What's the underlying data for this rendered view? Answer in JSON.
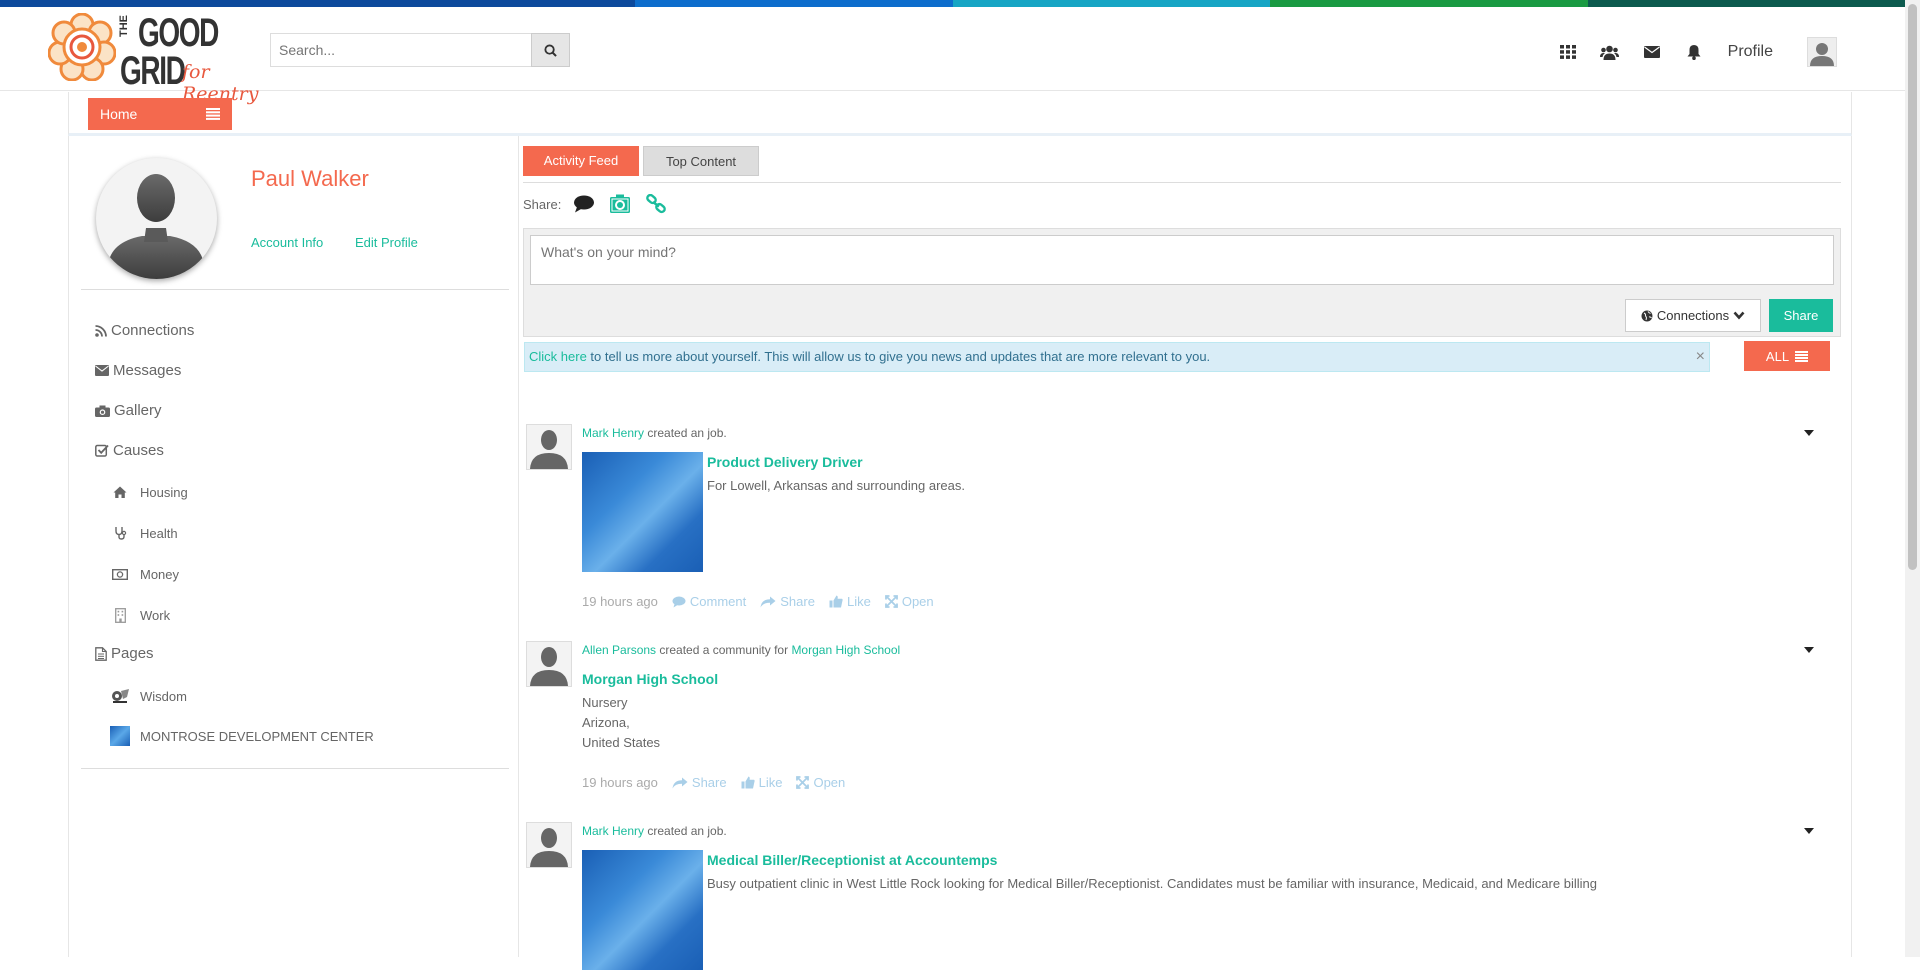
{
  "colors": {
    "accent": "#f4694e",
    "link": "#1abc9c",
    "info_bg": "#d9edf7",
    "top_stripes": [
      "#0d4a9c",
      "#0d4a9c",
      "#0d6dcc",
      "#16a5c4",
      "#1a9a42",
      "#0c5a4e"
    ]
  },
  "logo": {
    "the": "THE",
    "good": "GOOD",
    "grid": "GRID",
    "tagline": "for Reentry"
  },
  "search": {
    "placeholder": "Search..."
  },
  "header": {
    "profile_label": "Profile"
  },
  "subnav": {
    "home_label": "Home"
  },
  "user": {
    "name": "Paul Walker",
    "account_info": "Account Info",
    "edit_profile": "Edit Profile"
  },
  "sidebar": {
    "items": [
      {
        "label": "Connections",
        "icon": "rss-icon"
      },
      {
        "label": "Messages",
        "icon": "envelope-icon"
      },
      {
        "label": "Gallery",
        "icon": "camera-icon"
      },
      {
        "label": "Causes",
        "icon": "check-square-icon"
      }
    ],
    "causes": [
      {
        "label": "Housing",
        "icon": "home-icon"
      },
      {
        "label": "Health",
        "icon": "stethoscope-icon"
      },
      {
        "label": "Money",
        "icon": "money-icon"
      },
      {
        "label": "Work",
        "icon": "building-icon"
      }
    ],
    "pages_label": "Pages",
    "pages": [
      {
        "label": "Wisdom",
        "icon": "wisdom-page-icon"
      },
      {
        "label": "MONTROSE DEVELOPMENT CENTER",
        "icon": "montrose-page-icon"
      }
    ]
  },
  "tabs": {
    "activity_feed": "Activity Feed",
    "top_content": "Top Content"
  },
  "share": {
    "label": "Share:",
    "placeholder": "What's on your mind?",
    "connections_label": "Connections",
    "share_button": "Share"
  },
  "info": {
    "link_text": "Click here",
    "message": " to tell us more about yourself. This will allow us to give you news and updates that are more relevant to you.",
    "close": "×"
  },
  "filter": {
    "label": "ALL"
  },
  "feed": [
    {
      "author": "Mark Henry",
      "verb": " created an job.",
      "title": "Product Delivery Driver",
      "description": "For Lowell, Arkansas and surrounding areas.",
      "time": "19 hours ago",
      "comment": "Comment",
      "share": "Share",
      "like": "Like",
      "open": "Open"
    },
    {
      "author": "Allen Parsons",
      "verb": " created a community for ",
      "target": "Morgan High School",
      "title": "Morgan High School",
      "address": [
        "Nursery",
        "Arizona,",
        "United States"
      ],
      "time": "19 hours ago",
      "share": "Share",
      "like": "Like",
      "open": "Open"
    },
    {
      "author": "Mark Henry",
      "verb": " created an job.",
      "title": "Medical Biller/Receptionist at Accountemps",
      "description": "Busy outpatient clinic in West Little Rock looking for Medical Biller/Receptionist. Candidates must be familiar with insurance, Medicaid, and Medicare billing"
    }
  ]
}
